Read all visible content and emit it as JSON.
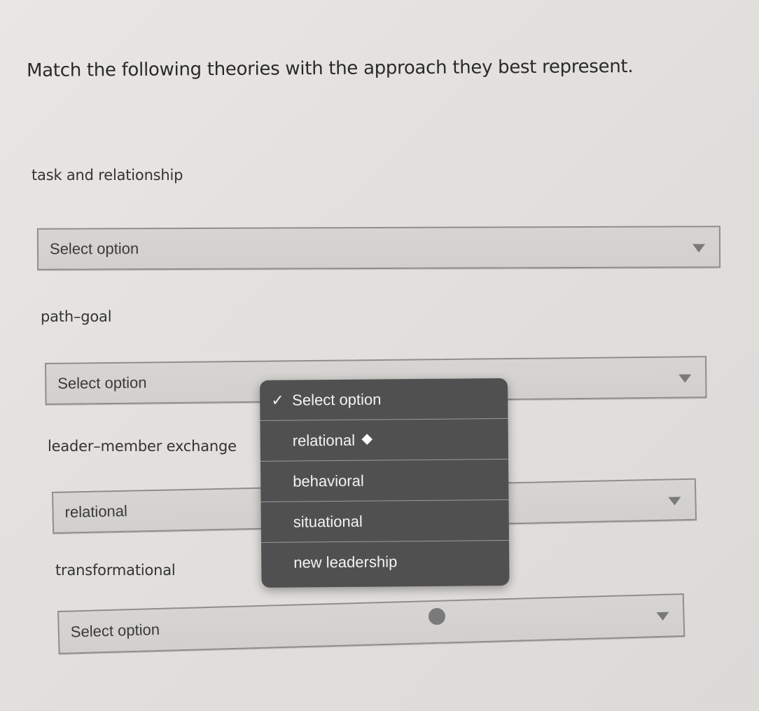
{
  "question": "Match the following theories with the approach they best represent.",
  "items": [
    {
      "theory": "task and relationship",
      "selected": "Select option"
    },
    {
      "theory": "path–goal",
      "selected": "Select option"
    },
    {
      "theory": "leader–member exchange",
      "selected": "relational"
    },
    {
      "theory": "transformational",
      "selected": "Select option"
    }
  ],
  "dropdown": {
    "open_for_item": 1,
    "options": [
      {
        "label": "Select option",
        "checked": true
      },
      {
        "label": "relational",
        "marker": "diamond"
      },
      {
        "label": "behavioral"
      },
      {
        "label": "situational"
      },
      {
        "label": "new leadership"
      }
    ]
  },
  "icons": {
    "check": "✓",
    "caret": "triangle-down-icon"
  }
}
